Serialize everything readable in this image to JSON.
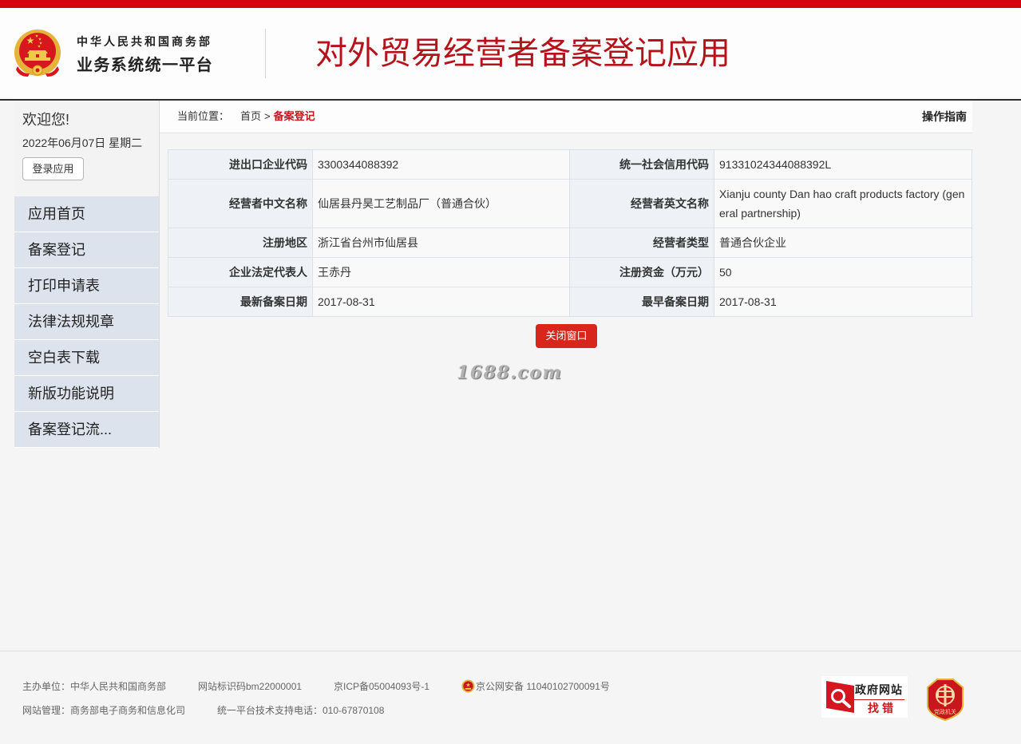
{
  "header": {
    "ministry": "中华人民共和国商务部",
    "platform": "业务系统统一平台",
    "title": "对外贸易经营者备案登记应用"
  },
  "sidebar": {
    "welcome": "欢迎您!",
    "date": "2022年06月07日 星期二",
    "login_label": "登录应用",
    "items": [
      {
        "label": "应用首页"
      },
      {
        "label": "备案登记"
      },
      {
        "label": "打印申请表"
      },
      {
        "label": "法律法规规章"
      },
      {
        "label": "空白表下载"
      },
      {
        "label": "新版功能说明"
      },
      {
        "label": "备案登记流..."
      }
    ]
  },
  "breadcrumb": {
    "prefix": "当前位置：",
    "home": "首页",
    "separator": ">",
    "current": "备案登记",
    "guide": "操作指南"
  },
  "record": {
    "rows": [
      {
        "left": {
          "label": "进出口企业代码",
          "value": "3300344088392"
        },
        "right": {
          "label": "统一社会信用代码",
          "value": "91331024344088392L"
        }
      },
      {
        "left": {
          "label": "经营者中文名称",
          "value": "仙居县丹昊工艺制品厂（普通合伙）"
        },
        "right": {
          "label": "经营者英文名称",
          "value": "Xianju county Dan hao craft products factory (general partnership)"
        }
      },
      {
        "left": {
          "label": "注册地区",
          "value": "浙江省台州市仙居县"
        },
        "right": {
          "label": "经营者类型",
          "value": "普通合伙企业"
        }
      },
      {
        "left": {
          "label": "企业法定代表人",
          "value": "王赤丹"
        },
        "right": {
          "label": "注册资金（万元）",
          "value": "50"
        }
      },
      {
        "left": {
          "label": "最新备案日期",
          "value": "2017-08-31"
        },
        "right": {
          "label": "最早备案日期",
          "value": "2017-08-31"
        }
      }
    ]
  },
  "close_label": "关闭窗口",
  "watermark": "1688.com",
  "footer": {
    "sponsor": "主办单位：中华人民共和国商务部",
    "site_id": "网站标识码bm22000001",
    "icp": "京ICP备05004093号-1",
    "police": "京公网安备 11040102700091号",
    "manager": "网站管理：商务部电子商务和信息化司",
    "support": "统一平台技术支持电话：010-67870108",
    "gov_badge_top": "政府网站",
    "gov_badge_bottom": "找错",
    "party_badge": "党政机关"
  },
  "icons": {
    "emblem": "national-emblem-icon",
    "police": "police-badge-icon",
    "gov_badge": "magnifier-icon",
    "party_badge": "party-government-badge-icon"
  },
  "colors": {
    "top_bar": "#d7000f",
    "title": "#b5131b",
    "accent": "#c8161d",
    "button": "#d8261d",
    "menu_bg": "#dce3ec",
    "label_bg": "#eef2f6",
    "page_bg": "#f5f5f5"
  }
}
